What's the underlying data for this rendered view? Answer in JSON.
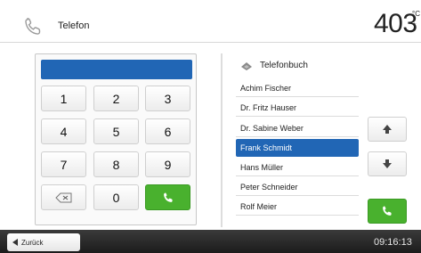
{
  "header": {
    "title": "Telefon",
    "temperature": "403",
    "unit": "°C",
    "mark": "*"
  },
  "keypad": {
    "display_value": "",
    "keys": [
      "1",
      "2",
      "3",
      "4",
      "5",
      "6",
      "7",
      "8",
      "9",
      "⌫",
      "0",
      "call"
    ]
  },
  "phonebook": {
    "title": "Telefonbuch",
    "contacts": [
      "Achim Fischer",
      "Dr. Fritz Hauser",
      "Dr. Sabine Weber",
      "Frank Schmidt",
      "Hans Müller",
      "Peter Schneider",
      "Rolf Meier"
    ],
    "selected": "Frank Schmidt"
  },
  "footer": {
    "back_label": "Zurück",
    "time": "09:16:13"
  },
  "colors": {
    "accent_blue": "#2166b5",
    "call_green": "#49b12e"
  },
  "icons": {
    "header": "phone-icon",
    "phonebook": "phonebook-icon",
    "up": "arrow-up-icon",
    "down": "arrow-down-icon",
    "back": "arrow-left-icon",
    "delete": "backspace-icon"
  }
}
